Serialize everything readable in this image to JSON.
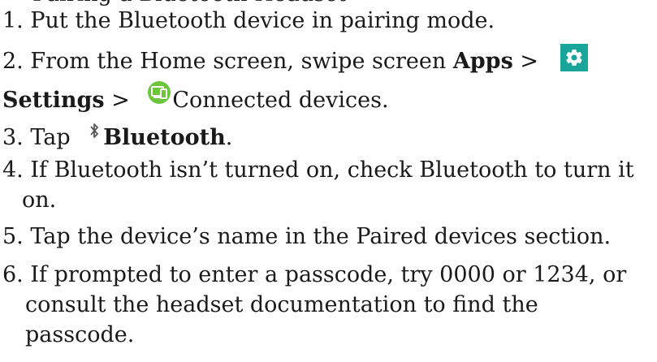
{
  "document": {
    "clipped_heading": "Pairing a Bluetooth Headset",
    "steps": {
      "s1": {
        "text": "1. Put the Bluetooth device in pairing mode."
      },
      "s2": {
        "prefix": "2. From the Home screen, swipe screen ",
        "apps": "Apps",
        "sep1": " > ",
        "settings": "Settings",
        "sep2": " > ",
        "connected": "Connected devices."
      },
      "s3": {
        "prefix": "3. Tap ",
        "bluetooth": "Bluetooth",
        "suffix": "."
      },
      "s4": {
        "line1": "4. If Bluetooth isn’t turned on, check Bluetooth to turn it",
        "line2": "on."
      },
      "s5": {
        "text": "5. Tap the device’s name in the Paired devices section."
      },
      "s6": {
        "line1": "6. If prompted to enter a passcode, try 0000 or 1234, or",
        "line2": "consult the headset documentation to find the",
        "line3": "passcode."
      }
    },
    "icons": {
      "settings": "gear-icon",
      "connected_devices": "connected-devices-icon",
      "bluetooth": "bluetooth-icon"
    },
    "colors": {
      "settings_icon_bg": "#1aa59a",
      "connected_icon_bg": "#6cc53a",
      "text": "#1a1a1a"
    }
  }
}
